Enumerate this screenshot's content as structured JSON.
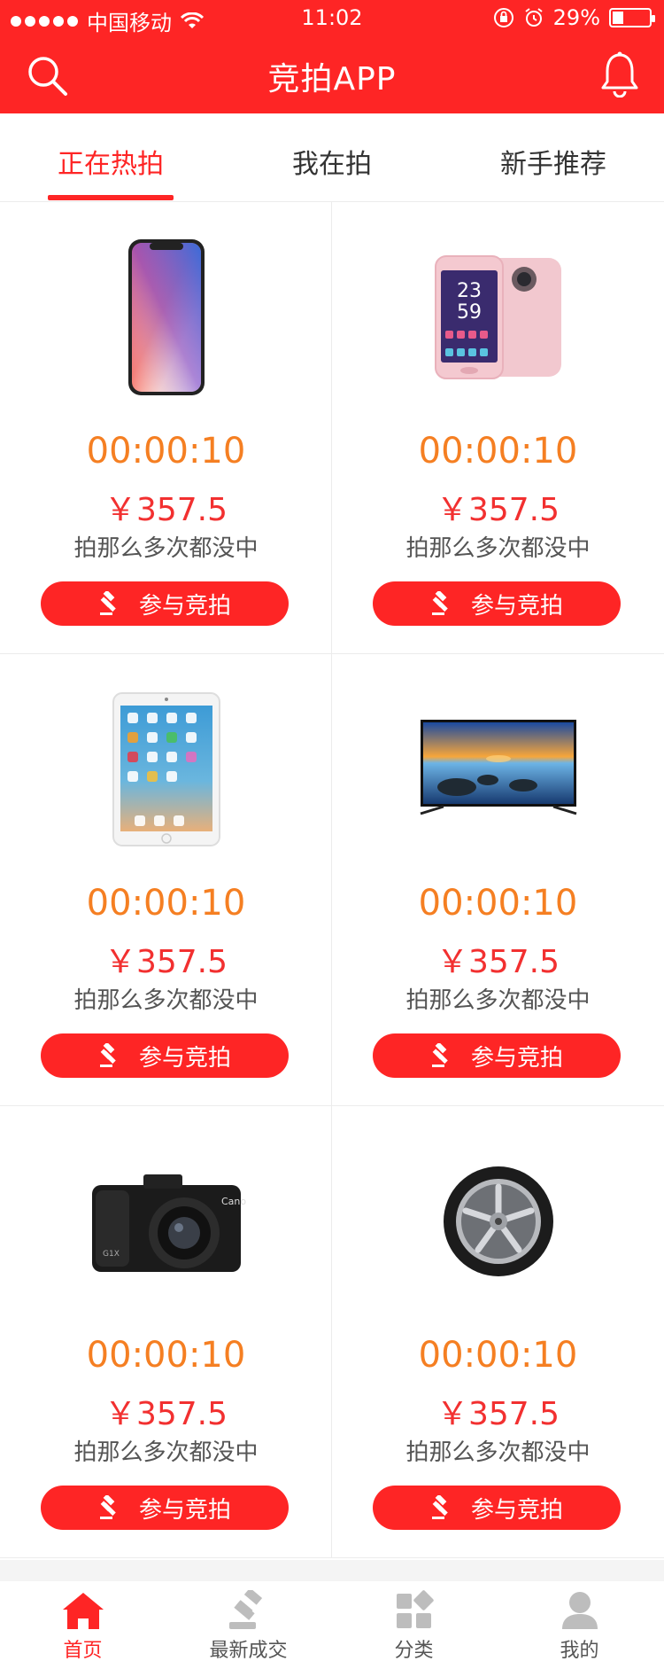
{
  "status_bar": {
    "carrier": "中国移动",
    "time": "11:02",
    "battery": "29%",
    "icons": [
      "signal-dots-icon",
      "wifi-icon",
      "lock-rotation-icon",
      "alarm-icon",
      "battery-icon"
    ]
  },
  "header": {
    "title": "竞拍APP",
    "left_icon": "search-icon",
    "right_icon": "bell-icon"
  },
  "tabs": [
    {
      "label": "正在热拍",
      "active": true
    },
    {
      "label": "我在拍",
      "active": false
    },
    {
      "label": "新手推荐",
      "active": false
    }
  ],
  "products": [
    {
      "image": "iphone-x",
      "timer": "00:00:10",
      "price": "￥357.5",
      "desc": "拍那么多次都没中",
      "button": "参与竞拍"
    },
    {
      "image": "pink-selfie-phone",
      "timer": "00:00:10",
      "price": "￥357.5",
      "desc": "拍那么多次都没中",
      "button": "参与竞拍"
    },
    {
      "image": "ipad",
      "timer": "00:00:10",
      "price": "￥357.5",
      "desc": "拍那么多次都没中",
      "button": "参与竞拍"
    },
    {
      "image": "tv",
      "timer": "00:00:10",
      "price": "￥357.5",
      "desc": "拍那么多次都没中",
      "button": "参与竞拍"
    },
    {
      "image": "camera",
      "timer": "00:00:10",
      "price": "￥357.5",
      "desc": "拍那么多次都没中",
      "button": "参与竞拍"
    },
    {
      "image": "tire",
      "timer": "00:00:10",
      "price": "￥357.5",
      "desc": "拍那么多次都没中",
      "button": "参与竞拍"
    }
  ],
  "camera_logo": "Canon",
  "camera_model": "G1X",
  "tabbar": [
    {
      "label": "首页",
      "icon": "home-icon",
      "active": true
    },
    {
      "label": "最新成交",
      "icon": "gavel-icon",
      "active": false
    },
    {
      "label": "分类",
      "icon": "category-icon",
      "active": false
    },
    {
      "label": "我的",
      "icon": "user-icon",
      "active": false
    }
  ],
  "colors": {
    "brand_red": "#fe2525",
    "timer_orange": "#f57f22",
    "price_red": "#f23030"
  }
}
